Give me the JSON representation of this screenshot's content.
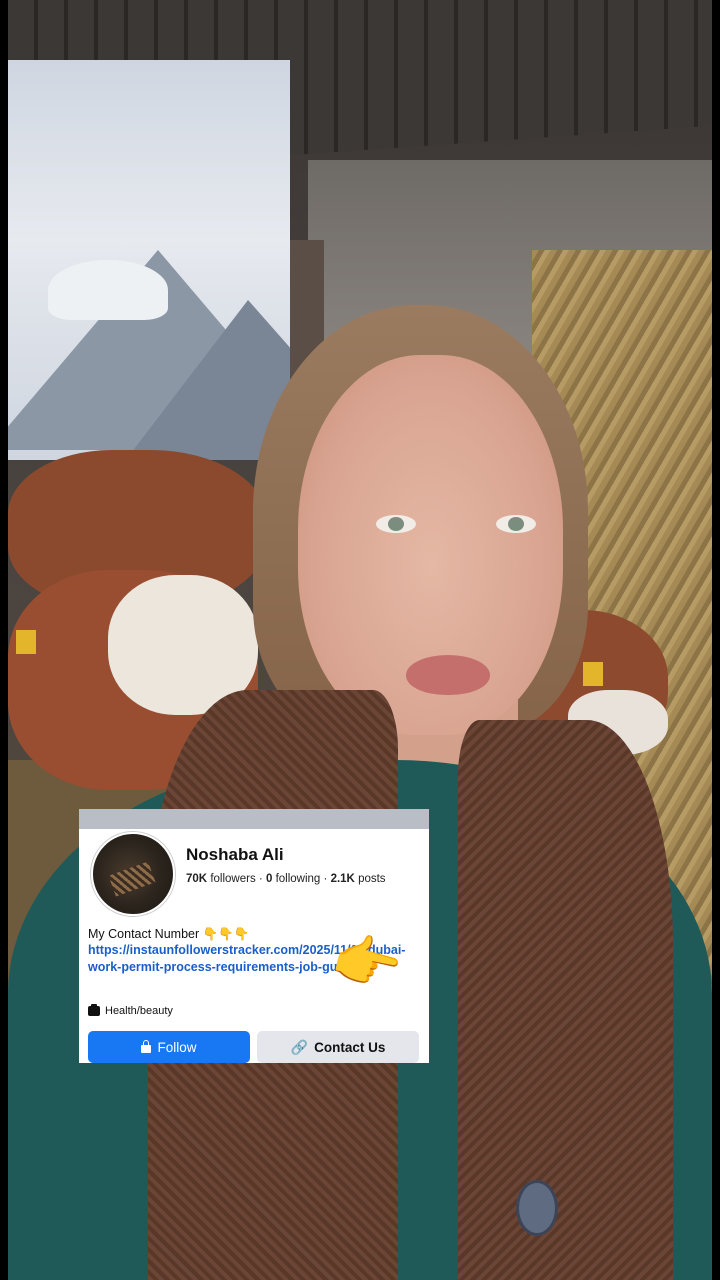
{
  "profile_card": {
    "name": "Noshaba Ali",
    "stats": {
      "followers_count": "70K",
      "followers_label": "followers",
      "following_count": "0",
      "following_label": "following",
      "posts_count": "2.1K",
      "posts_label": "posts",
      "separator": "·"
    },
    "bio_text": "My Contact Number",
    "bio_emojis": "👇👇👇",
    "link": "https://instaunfollowerstracker.com/2025/11/03/dubai-work-permit-process-requirements-job-guide/",
    "category": "Health/beauty",
    "follow_button_label": "Follow",
    "contact_button_label": "Contact Us"
  },
  "overlay": {
    "pointer_emoji": "👉"
  },
  "icons": {
    "category": "briefcase-icon",
    "follow": "lock-icon",
    "contact": "link-icon",
    "pointer": "pointing-hand-icon"
  },
  "colors": {
    "follow_button": "#1877f2",
    "contact_button": "#e4e6eb",
    "link": "#1a5fc9"
  }
}
